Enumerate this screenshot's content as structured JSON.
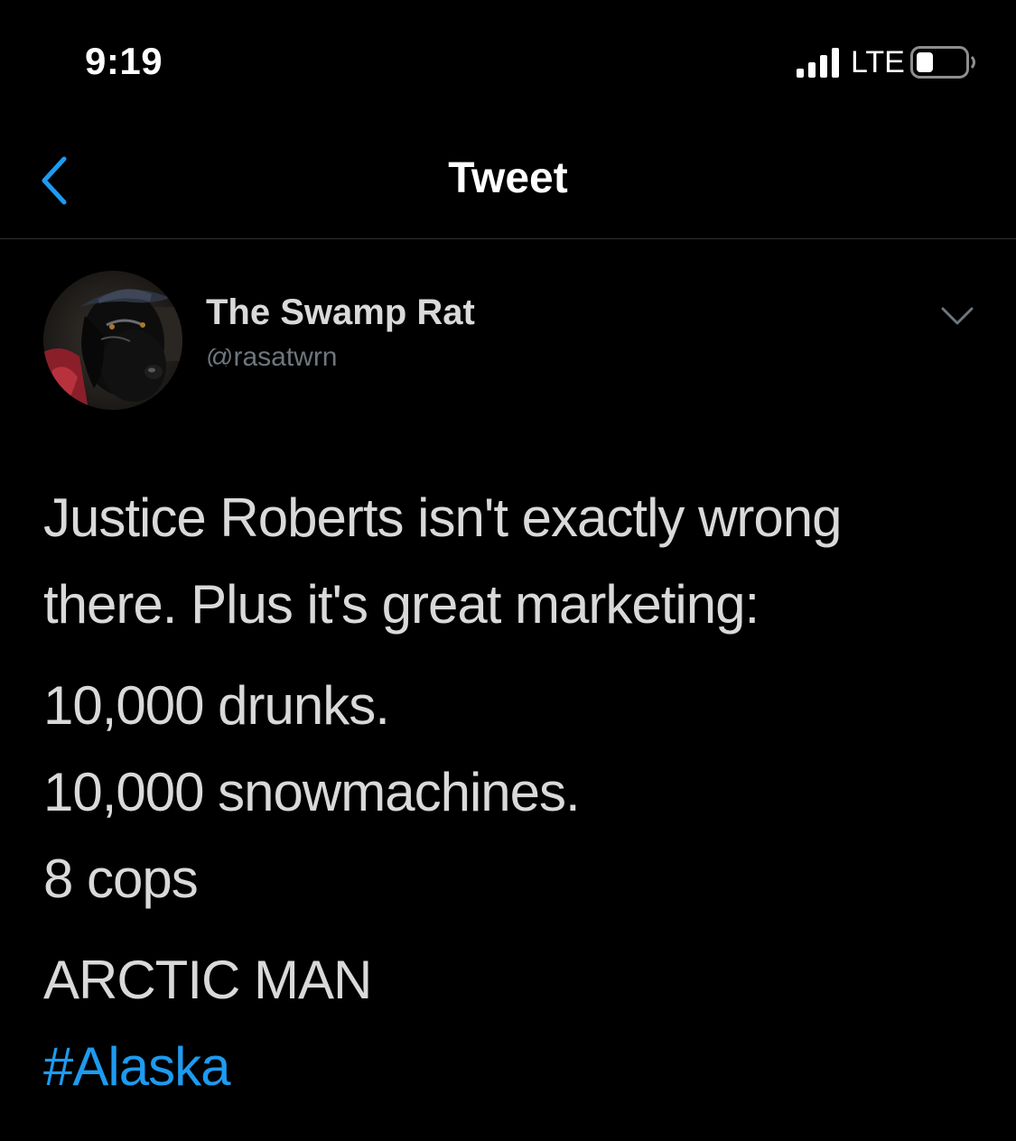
{
  "status_bar": {
    "time": "9:19",
    "network": "LTE",
    "icons": [
      "signal-icon",
      "battery-icon"
    ]
  },
  "nav": {
    "title": "Tweet",
    "back_icon": "chevron-left-icon"
  },
  "tweet": {
    "author": {
      "display_name": "The Swamp Rat",
      "handle": "@rasatwrn"
    },
    "more_icon": "chevron-down-icon",
    "lines": [
      "Justice Roberts isn't exactly wrong",
      "there. Plus it's great marketing:",
      "10,000 drunks.",
      "10,000 snowmachines.",
      "8 cops",
      "ARCTIC MAN"
    ],
    "hashtag": "#Alaska"
  },
  "colors": {
    "background": "#000000",
    "text": "#d9d9d9",
    "secondary_text": "#6e767d",
    "accent": "#1d9bf0",
    "divider": "#2f3336"
  }
}
